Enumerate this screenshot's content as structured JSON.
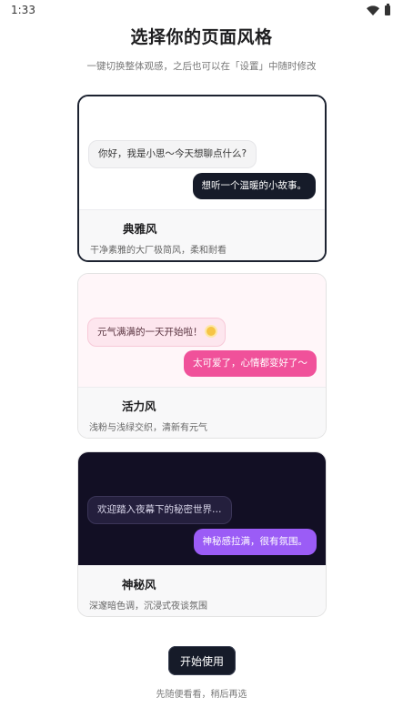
{
  "status_bar": {
    "time": "1:33"
  },
  "header": {
    "title": "选择你的页面风格",
    "subtitle": "一键切换整体观感，之后也可以在「设置」中随时修改"
  },
  "styles": [
    {
      "name": "典雅风",
      "description": "干净素雅的大厂极简风，柔和耐看",
      "preview": {
        "bubble_left": "你好，我是小思～今天想聊点什么?",
        "bubble_right": "想听一个温暖的小故事。"
      },
      "selected": true,
      "colors": {
        "preview_bg": "#ffffff",
        "user_bubble": "#161b29"
      }
    },
    {
      "name": "活力风",
      "description": "浅粉与浅绿交织，清新有元气",
      "preview": {
        "bubble_left": "元气满满的一天开始啦！",
        "bubble_right": "太可爱了，心情都变好了～"
      },
      "selected": false,
      "colors": {
        "preview_bg": "#fff6f9",
        "user_bubble": "#f0519a"
      }
    },
    {
      "name": "神秘风",
      "description": "深邃暗色调，沉浸式夜谈氛围",
      "preview": {
        "bubble_left": "欢迎踏入夜幕下的秘密世界…",
        "bubble_right": "神秘感拉满，很有氛围。"
      },
      "selected": false,
      "colors": {
        "preview_bg": "#120f24",
        "user_bubble": "#9b5cf6"
      }
    }
  ],
  "actions": {
    "start_label": "开始使用",
    "later_label": "先随便看看，稍后再选"
  }
}
